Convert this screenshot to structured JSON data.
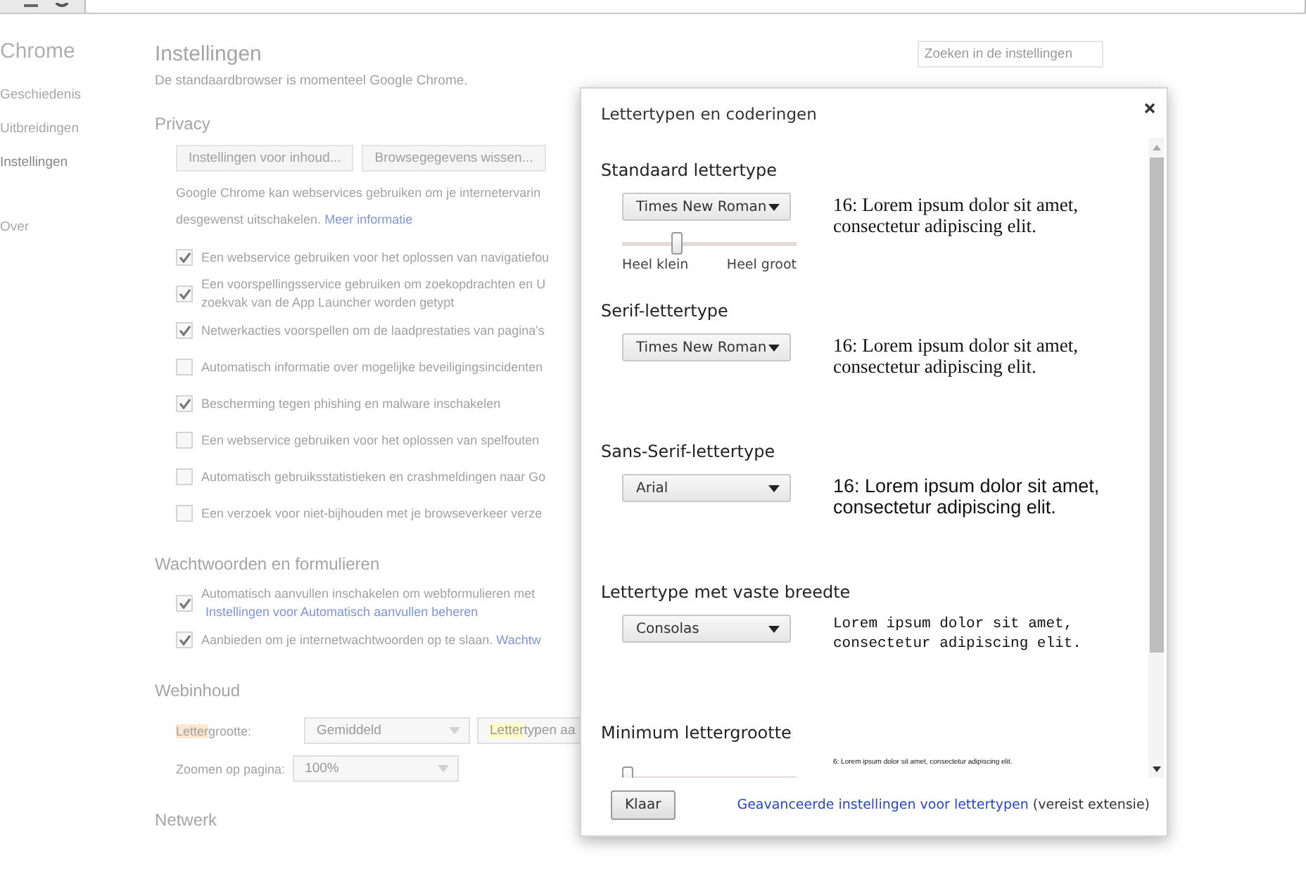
{
  "sidebar": {
    "title": "Chrome",
    "items": [
      {
        "label": "Geschiedenis",
        "selected": false
      },
      {
        "label": "Uitbreidingen",
        "selected": false
      },
      {
        "label": "Instellingen",
        "selected": true
      }
    ],
    "footer_items": [
      {
        "label": "Over",
        "selected": false
      }
    ]
  },
  "page": {
    "title": "Instellingen",
    "search": {
      "placeholder": "Zoeken in de instellingen"
    },
    "note": "De standaardbrowser is momenteel Google Chrome.",
    "sections": [
      {
        "heading": "Privacy",
        "items": [
          {
            "kind": "buttons",
            "buttons": [
              "Instellingen voor inhoud...",
              "Browsegegevens wissen..."
            ]
          },
          {
            "kind": "paragraph",
            "lines": [
              "Google Chrome kan webservices gebruiken om je internetervarin",
              "desgewenst uitschakelen."
            ],
            "link": "Meer informatie"
          },
          {
            "kind": "checkbox",
            "checked": true,
            "lines": [
              "Een webservice gebruiken voor het oplossen van navigatiefou"
            ]
          },
          {
            "kind": "checkbox",
            "checked": true,
            "lines": [
              "Een voorspellingsservice gebruiken om zoekopdrachten en U",
              "zoekvak van de App Launcher worden getypt"
            ]
          },
          {
            "kind": "checkbox",
            "checked": true,
            "lines": [
              "Netwerkacties voorspellen om de laadprestaties van pagina's"
            ]
          },
          {
            "kind": "checkbox",
            "checked": false,
            "lines": [
              "Automatisch informatie over mogelijke beveiligingsincidenten"
            ]
          },
          {
            "kind": "checkbox",
            "checked": true,
            "lines": [
              "Bescherming tegen phishing en malware inschakelen"
            ]
          },
          {
            "kind": "checkbox",
            "checked": false,
            "lines": [
              "Een webservice gebruiken voor het oplossen van spelfouten"
            ]
          },
          {
            "kind": "checkbox",
            "checked": false,
            "lines": [
              "Automatisch gebruiksstatistieken en crashmeldingen naar Go"
            ]
          },
          {
            "kind": "checkbox",
            "checked": false,
            "lines": [
              "Een verzoek voor niet-bijhouden met je browseverkeer verze"
            ]
          }
        ]
      },
      {
        "heading": "Wachtwoorden en formulieren",
        "items": [
          {
            "kind": "checkbox",
            "checked": true,
            "lines": [
              "Automatisch aanvullen inschakelen om webformulieren met"
            ],
            "link": "Instellingen voor Automatisch aanvullen beheren",
            "link_inline": false
          },
          {
            "kind": "checkbox",
            "checked": true,
            "lines": [
              "Aanbieden om je internetwachtwoorden op te slaan."
            ],
            "link": "Wachtw",
            "link_inline": true
          }
        ]
      },
      {
        "heading": "Webinhoud",
        "items": [
          {
            "kind": "select_row",
            "label_match": "Letter",
            "label": "grootte:",
            "label_match_current": true,
            "select": "Gemiddeld",
            "button_match": "Letter",
            "button": "typen aa",
            "button_match_current": false
          },
          {
            "kind": "select_row",
            "label": "Zoomen op pagina:",
            "select": "100%"
          }
        ]
      },
      {
        "heading": "Netwerk"
      }
    ]
  },
  "dialog": {
    "title": "Lettertypen en coderingen",
    "sections": [
      {
        "heading": "Standaard lettertype",
        "select": "Times New Roman",
        "preview": "16: Lorem ipsum dolor sit amet, consectetur adipiscing elit.",
        "kind": "serif",
        "slider": {
          "level": 0.3,
          "min_label": "Heel klein",
          "max_label": "Heel groot"
        }
      },
      {
        "heading": "Serif-lettertype",
        "select": "Times New Roman",
        "preview": "16: Lorem ipsum dolor sit amet, consectetur adipiscing elit.",
        "kind": "serif"
      },
      {
        "heading": "Sans-Serif-lettertype",
        "select": "Arial",
        "preview": "16: Lorem ipsum dolor sit amet, consectetur adipiscing elit.",
        "kind": "sans"
      },
      {
        "heading": "Lettertype met vaste breedte",
        "select": "Consolas",
        "preview": "Lorem ipsum dolor sit amet, consectetur adipiscing elit.",
        "kind": "mono"
      },
      {
        "heading": "Minimum lettergrootte",
        "preview": "6: Lorem ipsum dolor sit amet, consectetur adipiscing elit.",
        "kind": "tiny",
        "slider": {
          "level": 0
        }
      }
    ],
    "footer": {
      "button": "Klaar",
      "link": "Geavanceerde instellingen voor lettertypen",
      "note": "(vereist extensie)"
    }
  }
}
